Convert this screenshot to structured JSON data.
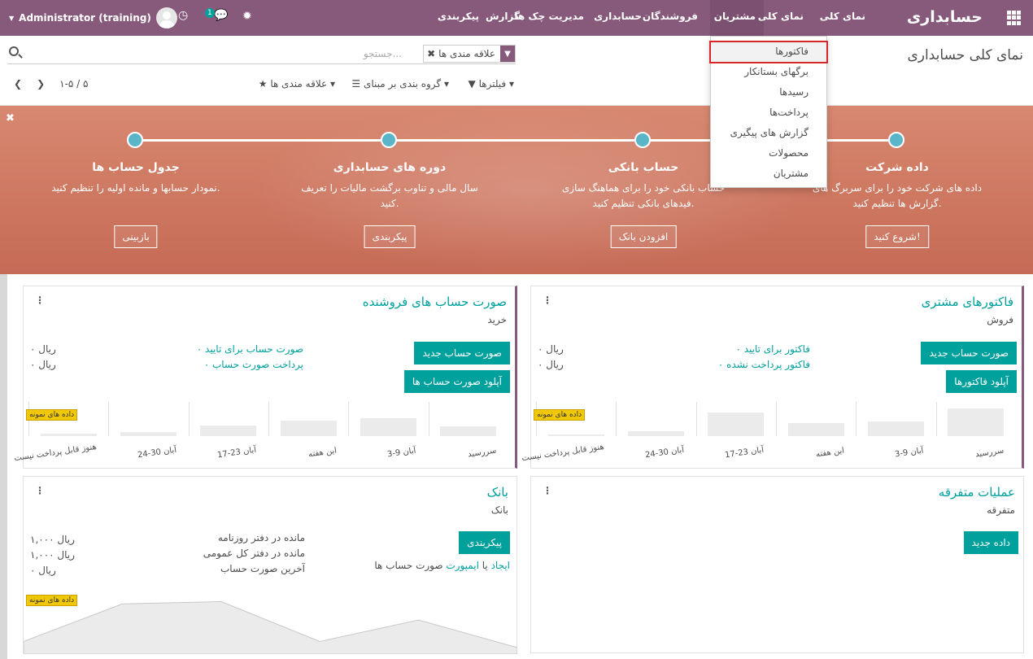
{
  "topbar": {
    "brand": "حسابداری",
    "menu": [
      "نمای کلی",
      "مشتریان",
      "فروشندگان",
      "حسابداری",
      "مدیریت چک ها",
      "گزارش",
      "پیکربندی"
    ],
    "overview_tab": "نمای کلی",
    "user": "Administrator (training)",
    "chat_badge": "1"
  },
  "control": {
    "title": "نمای کلی حسابداری",
    "search_placeholder": "جستجو...",
    "facet_label": "علاقه مندی ها",
    "filters": "فیلترها",
    "group_by": "گروه بندی بر مبنای",
    "favorites": "علاقه مندی ها",
    "pager": "۱-۵ / ۵"
  },
  "banner": {
    "steps": [
      {
        "title": "داده شرکت",
        "desc": "داده های شرکت خود را برای سربرگ های گزارش ها تنظیم کنید.",
        "button": "شروع کنید!"
      },
      {
        "title": "حساب بانکی",
        "desc": "حساب بانکی خود را برای هماهنگ سازی فیدهای بانکی تنظیم کنید.",
        "button": "افزودن بانک"
      },
      {
        "title": "دوره های حسابداری",
        "desc": "سال مالی و تناوب برگشت مالیات را تعریف کنید.",
        "button": "پیکربندی"
      },
      {
        "title": "جدول حساب ها",
        "desc": "نمودار حسابها و مانده اولیه را تنظیم کنید.",
        "button": "بازبینی"
      }
    ]
  },
  "dropdown": {
    "items": [
      "فاکتورها",
      "برگهای بستانکار",
      "رسیدها",
      "پرداخت‌ها",
      "گزارش های پیگیری",
      "محصولات",
      "مشتریان"
    ]
  },
  "cards": {
    "customer": {
      "title": "فاکتورهای مشتری",
      "subtitle": "فروش",
      "btn1": "صورت حساب جدید",
      "btn2": "آپلود فاکتورها",
      "link1": "۰ فاکتور برای تایید",
      "link2": "۰ فاکتور پرداخت نشده",
      "val1": "۰ ریال",
      "val2": "۰ ریال",
      "sample": "داده های نمونه",
      "ticks": [
        "سررسید",
        "3-9 آبان",
        "این هفته",
        "17-23 آبان",
        "24-30 آبان",
        "هنوز قابل پرداخت نیست"
      ]
    },
    "vendor": {
      "title": "صورت حساب های فروشنده",
      "subtitle": "خرید",
      "btn1": "صورت حساب جدید",
      "btn2": "آپلود صورت حساب ها",
      "link1": "۰ صورت حساب برای تایید",
      "link2": "۰ پرداخت صورت حساب",
      "val1": "۰ ریال",
      "val2": "۰ ریال",
      "sample": "داده های نمونه",
      "ticks": [
        "سررسید",
        "3-9 آبان",
        "این هفته",
        "17-23 آبان",
        "24-30 آبان",
        "هنوز قابل پرداخت نیست"
      ]
    },
    "misc": {
      "title": "عملیات متفرقه",
      "subtitle": "متفرقه",
      "btn1": "داده جدید"
    },
    "bank": {
      "title": "بانک",
      "subtitle": "بانک",
      "btn1": "پیکربندی",
      "create": "ایجاد",
      "or": "یا",
      "import": "ایمپورت",
      "statements": "صورت حساب ها",
      "label1": "مانده در دفتر روزنامه",
      "label2": "مانده در دفتر کل عمومی",
      "label3": "آخرین صورت حساب",
      "val1": "۱,۰۰۰ ریال",
      "val2": "۱,۰۰۰ ریال",
      "val3": "۰ ریال",
      "sample": "داده های نمونه"
    }
  },
  "chart_data": [
    {
      "type": "bar",
      "categories": [
        "سررسید",
        "3-9 آبان",
        "این هفته",
        "17-23 آبان",
        "24-30 آبان",
        "هنوز قابل پرداخت نیست"
      ],
      "values": [
        34,
        18,
        16,
        29,
        6,
        0
      ],
      "series_note": "customer"
    },
    {
      "type": "bar",
      "categories": [
        "سررسید",
        "3-9 آبان",
        "این هفته",
        "17-23 آبان",
        "24-30 آبان",
        "هنوز قابل پرداخت نیست"
      ],
      "values": [
        12,
        22,
        19,
        13,
        5,
        3
      ],
      "series_note": "vendor"
    },
    {
      "type": "area",
      "x": [
        0,
        1,
        2,
        3,
        4,
        5
      ],
      "values": [
        8,
        57,
        60,
        8,
        36,
        0
      ]
    }
  ],
  "colors": {
    "brand": "#875a7b",
    "accent": "#00a09d",
    "highlight": "#d9262a"
  }
}
